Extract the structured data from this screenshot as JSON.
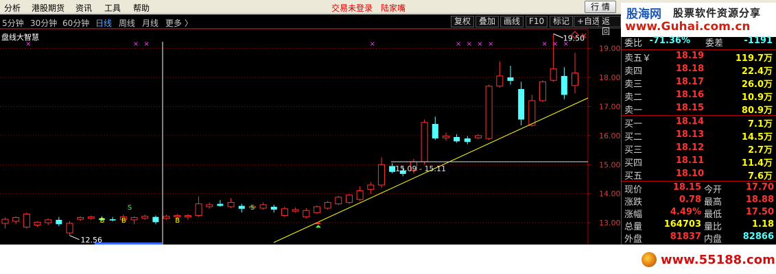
{
  "menu": {
    "items": [
      "分析",
      "港股期货",
      "资讯",
      "工具",
      "帮助"
    ],
    "status_trade": "交易未登录",
    "status_user": "陆家嘴",
    "quote_button": "行 情",
    "window_buttons": "_ □ ×"
  },
  "watermark_top": {
    "logo": "股海网",
    "tagline": "股票软件资源分享",
    "url": "www.Guhai.com.cn"
  },
  "periods": [
    {
      "label": "5分钟",
      "active": false
    },
    {
      "label": "30分钟",
      "active": false
    },
    {
      "label": "60分钟",
      "active": false
    },
    {
      "label": "日线",
      "active": true
    },
    {
      "label": "周线",
      "active": false
    },
    {
      "label": "月线",
      "active": false
    },
    {
      "label": "更多 〉",
      "active": false
    }
  ],
  "toolbar": [
    "复权",
    "叠加",
    "画线",
    "F10",
    "标记",
    "+自选",
    "返回"
  ],
  "indicator_name": "盘线大智慧",
  "chart_data": {
    "type": "candlestick",
    "y_axis_labels": [
      "19.00",
      "18.00",
      "17.00",
      "16.00",
      "15.00",
      "14.00",
      "13.00"
    ],
    "ylim": [
      12.25,
      19.65
    ],
    "annotations": {
      "high": "19.50",
      "low": "12.56",
      "box": "15.09 - 15.11"
    },
    "marker_labels": [
      "B",
      "B",
      "S",
      "S",
      "B"
    ],
    "candles": [
      {
        "o": 12.98,
        "h": 13.18,
        "l": 12.8,
        "c": 13.12
      },
      {
        "o": 13.05,
        "h": 13.22,
        "l": 12.95,
        "c": 13.18
      },
      {
        "o": 12.85,
        "h": 13.35,
        "l": 12.8,
        "c": 13.3
      },
      {
        "o": 12.92,
        "h": 13.05,
        "l": 12.86,
        "c": 13.02
      },
      {
        "o": 13.0,
        "h": 13.15,
        "l": 12.92,
        "c": 13.1
      },
      {
        "o": 13.1,
        "h": 13.2,
        "l": 12.88,
        "c": 12.95
      },
      {
        "o": 12.65,
        "h": 13.05,
        "l": 12.56,
        "c": 12.98
      },
      {
        "o": 13.12,
        "h": 13.22,
        "l": 13.06,
        "c": 13.18
      },
      {
        "o": 13.15,
        "h": 13.25,
        "l": 13.1,
        "c": 13.2
      },
      {
        "o": 13.15,
        "h": 13.22,
        "l": 13.06,
        "c": 13.1
      },
      {
        "o": 13.12,
        "h": 13.2,
        "l": 13.05,
        "c": 13.08
      },
      {
        "o": 13.1,
        "h": 13.28,
        "l": 13.05,
        "c": 13.2
      },
      {
        "o": 13.1,
        "h": 13.22,
        "l": 12.95,
        "c": 13.18
      },
      {
        "o": 13.15,
        "h": 13.28,
        "l": 13.1,
        "c": 13.22
      },
      {
        "o": 13.2,
        "h": 13.25,
        "l": 12.95,
        "c": 13.02
      },
      {
        "o": 13.15,
        "h": 13.28,
        "l": 13.1,
        "c": 13.22
      },
      {
        "o": 13.2,
        "h": 13.3,
        "l": 13.12,
        "c": 13.25
      },
      {
        "o": 13.2,
        "h": 13.3,
        "l": 13.1,
        "c": 13.25
      },
      {
        "o": 13.25,
        "h": 13.9,
        "l": 13.2,
        "c": 13.65
      },
      {
        "o": 13.55,
        "h": 13.7,
        "l": 13.48,
        "c": 13.62
      },
      {
        "o": 13.65,
        "h": 13.78,
        "l": 13.55,
        "c": 13.58
      },
      {
        "o": 13.55,
        "h": 13.85,
        "l": 13.5,
        "c": 13.7
      },
      {
        "o": 13.58,
        "h": 13.65,
        "l": 13.35,
        "c": 13.48
      },
      {
        "o": 13.52,
        "h": 13.6,
        "l": 13.45,
        "c": 13.56
      },
      {
        "o": 13.5,
        "h": 13.7,
        "l": 13.45,
        "c": 13.62
      },
      {
        "o": 13.55,
        "h": 13.62,
        "l": 13.35,
        "c": 13.45
      },
      {
        "o": 13.25,
        "h": 13.55,
        "l": 13.2,
        "c": 13.48
      },
      {
        "o": 13.4,
        "h": 13.52,
        "l": 13.35,
        "c": 13.45
      },
      {
        "o": 13.2,
        "h": 13.5,
        "l": 13.15,
        "c": 13.42
      },
      {
        "o": 13.35,
        "h": 13.6,
        "l": 13.3,
        "c": 13.55
      },
      {
        "o": 13.5,
        "h": 13.75,
        "l": 13.45,
        "c": 13.7
      },
      {
        "o": 13.65,
        "h": 13.92,
        "l": 13.6,
        "c": 13.88
      },
      {
        "o": 13.7,
        "h": 14.0,
        "l": 13.65,
        "c": 13.95
      },
      {
        "o": 13.8,
        "h": 14.25,
        "l": 13.75,
        "c": 14.1
      },
      {
        "o": 14.15,
        "h": 14.4,
        "l": 14.0,
        "c": 14.3
      },
      {
        "o": 14.3,
        "h": 15.25,
        "l": 14.2,
        "c": 15.0
      },
      {
        "o": 14.95,
        "h": 15.05,
        "l": 14.7,
        "c": 14.75
      },
      {
        "o": 14.8,
        "h": 14.95,
        "l": 14.6,
        "c": 14.68
      },
      {
        "o": 14.8,
        "h": 15.2,
        "l": 14.7,
        "c": 15.1
      },
      {
        "o": 15.1,
        "h": 16.55,
        "l": 15.0,
        "c": 16.45
      },
      {
        "o": 16.4,
        "h": 16.65,
        "l": 15.85,
        "c": 15.9
      },
      {
        "o": 15.92,
        "h": 16.1,
        "l": 15.82,
        "c": 15.98
      },
      {
        "o": 15.95,
        "h": 16.05,
        "l": 15.75,
        "c": 15.8
      },
      {
        "o": 15.9,
        "h": 15.98,
        "l": 15.7,
        "c": 15.78
      },
      {
        "o": 15.92,
        "h": 16.05,
        "l": 15.88,
        "c": 16.0
      },
      {
        "o": 15.9,
        "h": 17.75,
        "l": 15.85,
        "c": 17.7
      },
      {
        "o": 17.7,
        "h": 18.55,
        "l": 17.65,
        "c": 18.05
      },
      {
        "o": 18.0,
        "h": 18.4,
        "l": 17.75,
        "c": 17.88
      },
      {
        "o": 17.6,
        "h": 17.85,
        "l": 16.35,
        "c": 16.55
      },
      {
        "o": 16.35,
        "h": 17.4,
        "l": 16.3,
        "c": 17.2
      },
      {
        "o": 17.2,
        "h": 17.9,
        "l": 17.15,
        "c": 17.85
      },
      {
        "o": 17.9,
        "h": 19.5,
        "l": 17.85,
        "c": 18.3
      },
      {
        "o": 18.05,
        "h": 18.35,
        "l": 17.25,
        "c": 17.4
      },
      {
        "o": 17.72,
        "h": 18.85,
        "l": 17.45,
        "c": 18.15
      }
    ],
    "trendline": {
      "from": 13.25,
      "to": 18.15
    }
  },
  "panel": {
    "commission": {
      "ratio_label": "委比",
      "ratio": "-71.36%",
      "diff_label": "委差",
      "diff": "-1191"
    },
    "sells": [
      {
        "label": "卖五￥",
        "price": "18.19",
        "vol": "119.7万"
      },
      {
        "label": "卖四",
        "price": "18.18",
        "vol": "22.4万"
      },
      {
        "label": "卖三",
        "price": "18.17",
        "vol": "26.0万"
      },
      {
        "label": "卖二",
        "price": "18.16",
        "vol": "10.9万"
      },
      {
        "label": "卖一",
        "price": "18.15",
        "vol": "80.9万"
      }
    ],
    "buys": [
      {
        "label": "买一",
        "price": "18.14",
        "vol": "7.1万"
      },
      {
        "label": "买二",
        "price": "18.13",
        "vol": "14.5万"
      },
      {
        "label": "买三",
        "price": "18.12",
        "vol": "2.7万"
      },
      {
        "label": "买四",
        "price": "18.11",
        "vol": "11.4万"
      },
      {
        "label": "买五",
        "price": "18.10",
        "vol": "7.6万"
      }
    ],
    "stats": [
      {
        "k1": "现价",
        "v1": "18.15",
        "k2": "今开",
        "v2": "17.70"
      },
      {
        "k1": "涨跌",
        "v1": "0.78",
        "k2": "最高",
        "v2": "18.88"
      },
      {
        "k1": "涨幅",
        "v1": "4.49%",
        "k2": "最低",
        "v2": "17.50"
      },
      {
        "k1": "总量",
        "v1": "164703",
        "k2": "量比",
        "v2": "1.18"
      },
      {
        "k1": "外盘",
        "v1": "81837",
        "k2": "内盘",
        "v2": "82866"
      }
    ]
  },
  "watermark_bottom": {
    "url": "www.55188.com"
  },
  "colors": {
    "up": "#ff3232",
    "down": "#54ffff",
    "grid": "#8a1010",
    "price_up": "#ff3232",
    "price_even": "#ffff00"
  }
}
